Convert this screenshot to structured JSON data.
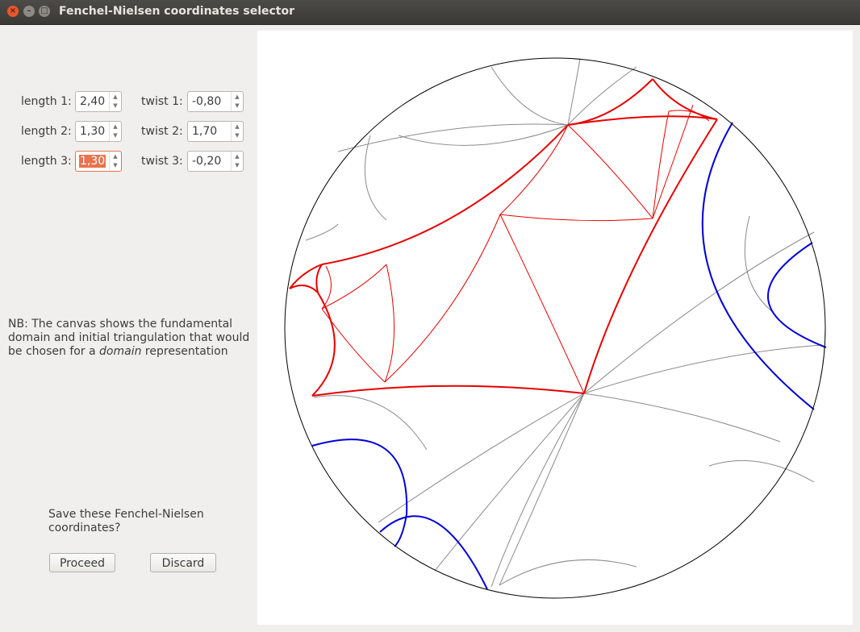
{
  "window": {
    "title": "Fenchel-Nielsen coordinates selector",
    "close_glyph": "×",
    "min_glyph": "–",
    "max_glyph": "□"
  },
  "fields": {
    "length1": {
      "label": "length 1:",
      "value": "2,40"
    },
    "length2": {
      "label": "length 2:",
      "value": "1,30"
    },
    "length3": {
      "label": "length 3:",
      "value": "1,30"
    },
    "twist1": {
      "label": "twist 1:",
      "value": "-0,80"
    },
    "twist2": {
      "label": "twist 2:",
      "value": "1,70"
    },
    "twist3": {
      "label": "twist 3:",
      "value": "-0,20"
    }
  },
  "spin_up_glyph": "▲",
  "spin_down_glyph": "▼",
  "note": {
    "prefix": "NB: The canvas shows the fundamental domain and initial triangulation that would be chosen for a ",
    "emph": "domain",
    "suffix": " representation"
  },
  "save": {
    "question": "Save these Fenchel-Nielsen coordinates?",
    "proceed_label": "Proceed",
    "discard_label": "Discard"
  },
  "colors": {
    "triangulation": "#e80000",
    "boundary_arcs": "#0000d8",
    "tiling": "#8a8a8a"
  }
}
